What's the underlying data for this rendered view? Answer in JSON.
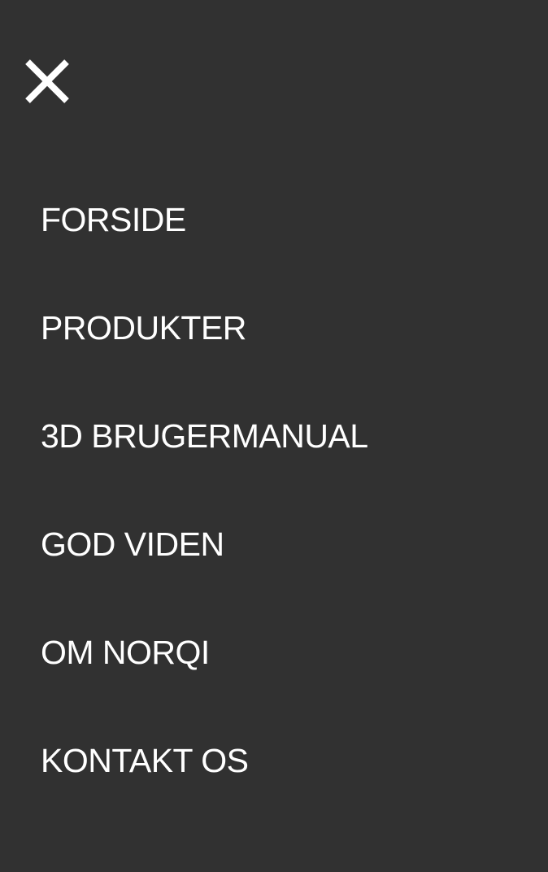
{
  "colors": {
    "background": "#313131",
    "text": "#ffffff"
  },
  "close_button": {
    "icon": "close-icon"
  },
  "nav": {
    "items": [
      {
        "label": "FORSIDE"
      },
      {
        "label": "PRODUKTER"
      },
      {
        "label": "3D BRUGERMANUAL"
      },
      {
        "label": "GOD VIDEN"
      },
      {
        "label": "OM NORQI"
      },
      {
        "label": "KONTAKT OS"
      }
    ]
  }
}
